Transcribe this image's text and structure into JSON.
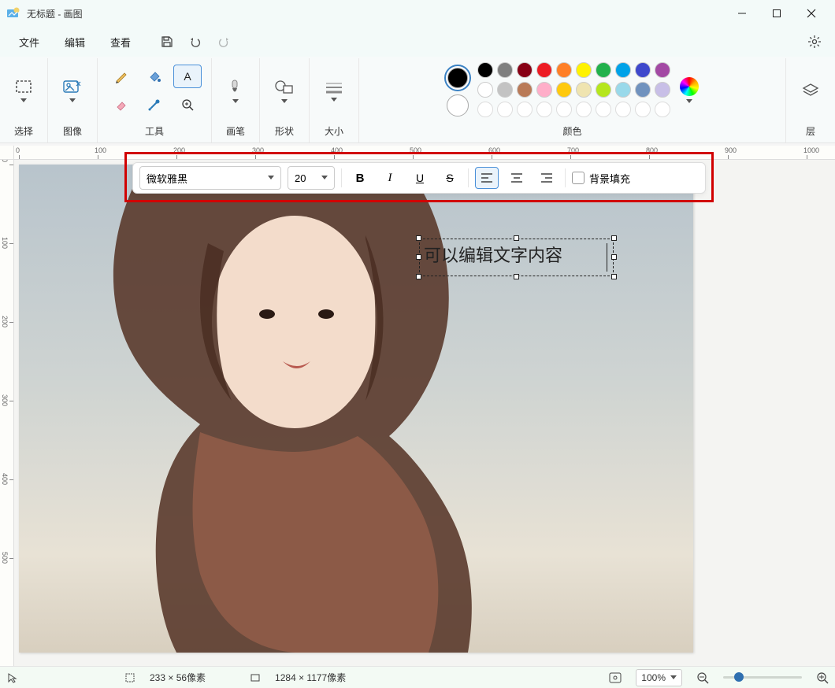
{
  "window": {
    "title": "无标题 - 画图"
  },
  "menubar": {
    "file": "文件",
    "edit": "编辑",
    "view": "查看"
  },
  "ribbon": {
    "select": "选择",
    "image": "图像",
    "tools": "工具",
    "brushes": "画笔",
    "shapes": "形状",
    "size": "大小",
    "colors": "颜色",
    "layers": "层"
  },
  "colors": {
    "current1": "#000000",
    "current2": "#ffffff",
    "row1": [
      "#000000",
      "#7f7f7f",
      "#880015",
      "#ed1c24",
      "#ff7f27",
      "#fff200",
      "#22b14c",
      "#00a2e8",
      "#3f48cc",
      "#a349a4"
    ],
    "row2": [
      "#ffffff",
      "#c3c3c3",
      "#b97a57",
      "#ffaec9",
      "#ffc90e",
      "#efe4b0",
      "#b5e61d",
      "#99d9ea",
      "#7092be",
      "#c8bfe7"
    ],
    "row3": [
      "#ffffff",
      "#ffffff",
      "#ffffff",
      "#ffffff",
      "#ffffff",
      "#ffffff",
      "#ffffff",
      "#ffffff",
      "#ffffff",
      "#ffffff"
    ]
  },
  "text_toolbar": {
    "font": "微软雅黑",
    "size": "20",
    "bg_fill": "背景填充"
  },
  "canvas": {
    "text_content": "可以编辑文字内容"
  },
  "ruler_h": [
    "0",
    "100",
    "200",
    "300",
    "400",
    "500",
    "600",
    "700",
    "800",
    "900",
    "1000"
  ],
  "ruler_v": [
    "0",
    "100",
    "200",
    "300",
    "400",
    "500"
  ],
  "statusbar": {
    "selection": "233 × 56像素",
    "canvas_size": "1284 × 1177像素",
    "zoom": "100%"
  }
}
